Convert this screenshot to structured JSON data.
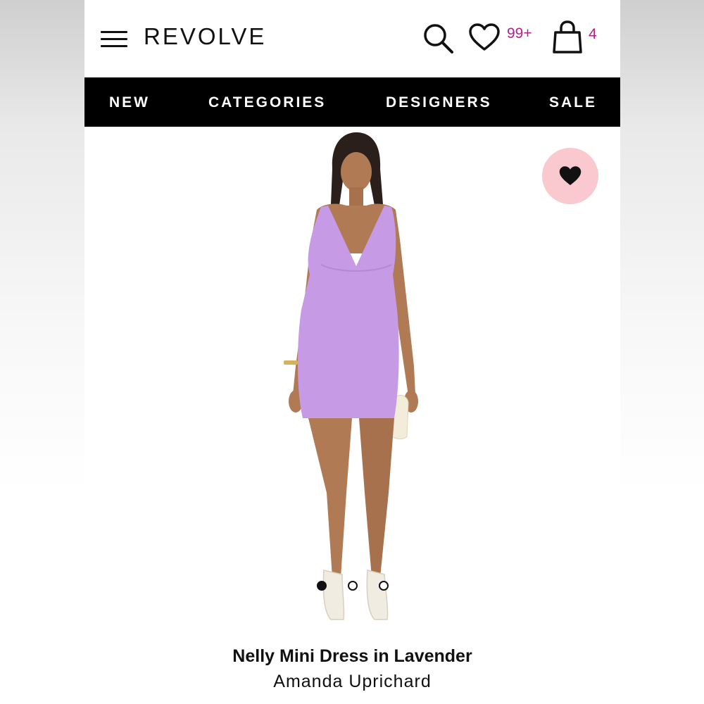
{
  "header": {
    "logo": "REVOLVE",
    "wishlist_count": "99+",
    "bag_count": "4",
    "accent_color": "#b0228c"
  },
  "nav": {
    "items": [
      {
        "label": "NEW"
      },
      {
        "label": "CATEGORIES"
      },
      {
        "label": "DESIGNERS"
      },
      {
        "label": "SALE"
      }
    ]
  },
  "product": {
    "title": "Nelly Mini Dress in Lavender",
    "designer": "Amanda Uprichard",
    "dress_color": "#c79ae6",
    "image_count": 3,
    "active_image": 1
  },
  "icons": {
    "menu": "menu-icon",
    "search": "search-icon",
    "wishlist": "heart-outline-icon",
    "bag": "shopping-bag-icon",
    "favorite": "heart-filled-icon"
  }
}
